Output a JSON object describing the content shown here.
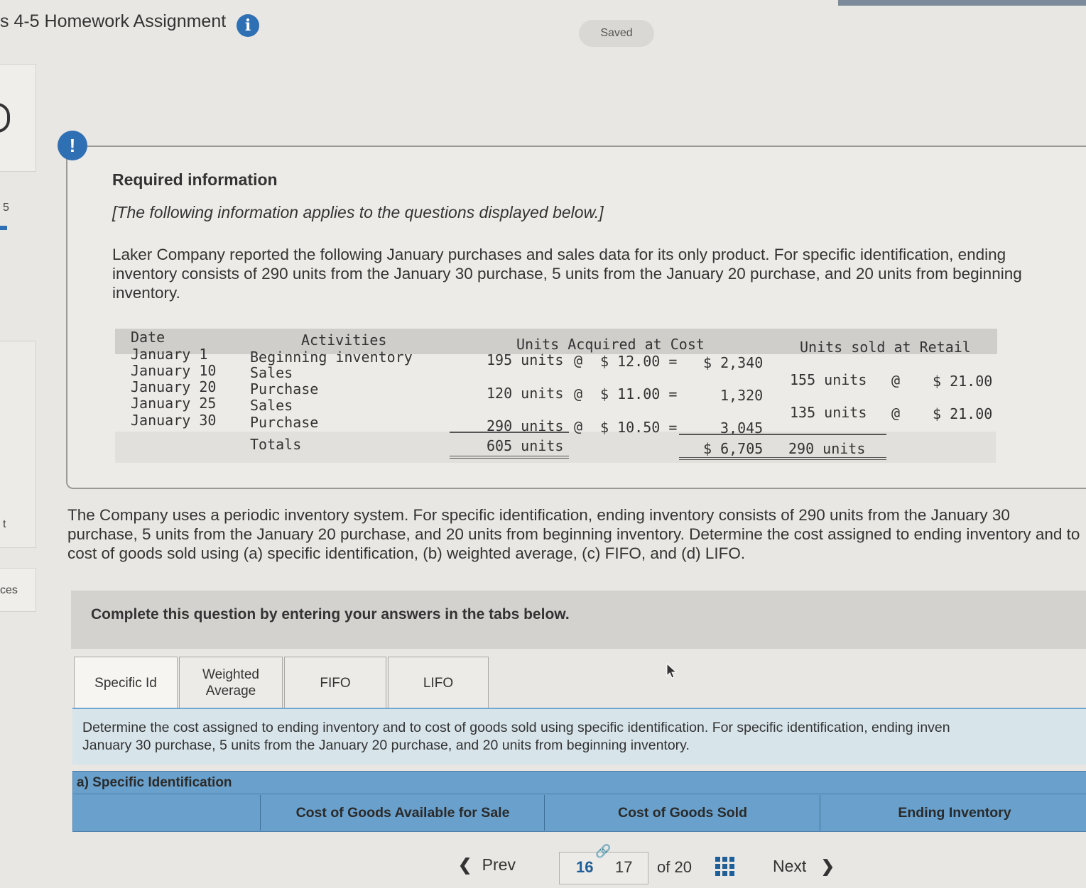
{
  "header": {
    "title": "s 4-5 Homework Assignment",
    "info_icon": "i",
    "saved": "Saved"
  },
  "sidebar": {
    "item_5": "5",
    "item_t": "t",
    "item_ces": "ces"
  },
  "info": {
    "alert_icon": "!",
    "title": "Required information",
    "note": "[The following information applies to the questions displayed below.]",
    "paragraph": "Laker Company reported the following January purchases and sales data for its only product. For specific identification, ending inventory consists of 290 units from the January 30 purchase, 5 units from the January 20 purchase, and 20 units from beginning inventory."
  },
  "table": {
    "headers": {
      "date": "Date",
      "activities": "Activities",
      "acquired": "Units Acquired at Cost",
      "sold": "Units sold at Retail"
    },
    "rows": [
      {
        "date": "January 1",
        "activity": "Beginning inventory",
        "acq_units": "195 units",
        "at": "@",
        "acq_cost": "$ 12.00 =",
        "acq_total": "$ 2,340",
        "sold_units": "",
        "sold_at": "",
        "sold_price": ""
      },
      {
        "date": "January 10",
        "activity": "Sales",
        "acq_units": "",
        "at": "",
        "acq_cost": "",
        "acq_total": "",
        "sold_units": "155 units",
        "sold_at": "@",
        "sold_price": "$ 21.00"
      },
      {
        "date": "January 20",
        "activity": "Purchase",
        "acq_units": "120 units",
        "at": "@",
        "acq_cost": "$ 11.00 =",
        "acq_total": "1,320",
        "sold_units": "",
        "sold_at": "",
        "sold_price": ""
      },
      {
        "date": "January 25",
        "activity": "Sales",
        "acq_units": "",
        "at": "",
        "acq_cost": "",
        "acq_total": "",
        "sold_units": "135 units",
        "sold_at": "@",
        "sold_price": "$ 21.00"
      },
      {
        "date": "January 30",
        "activity": "Purchase",
        "acq_units": "290 units",
        "at": "@",
        "acq_cost": "$ 10.50 =",
        "acq_total": "3,045",
        "sold_units": "",
        "sold_at": "",
        "sold_price": ""
      }
    ],
    "totals": {
      "label": "Totals",
      "acq_units": "605 units",
      "acq_total": "$ 6,705",
      "sold_units": "290 units"
    }
  },
  "question": {
    "text": "The Company uses a periodic inventory system. For specific identification, ending inventory consists of 290 units from the January 30 purchase, 5 units from the January 20 purchase, and 20 units from beginning inventory. Determine the cost assigned to ending inventory and to cost of goods sold using (a) specific identification, (b) weighted average, (c) FIFO, and (d) LIFO."
  },
  "complete": {
    "text": "Complete this question by entering your answers in the tabs below."
  },
  "tabs": [
    {
      "label": "Specific Id"
    },
    {
      "label": "Weighted Average"
    },
    {
      "label": "FIFO"
    },
    {
      "label": "LIFO"
    }
  ],
  "instruction": {
    "line1": "Determine the cost assigned to ending inventory and to cost of goods sold using specific identification. For specific identification, ending inven",
    "line2": "January 30 purchase, 5 units from the January 20 purchase, and 20 units from beginning inventory."
  },
  "answer_table": {
    "title": "a) Specific Identification",
    "col1": "Cost of Goods Available for Sale",
    "col2": "Cost of Goods Sold",
    "col3": "Ending Inventory"
  },
  "nav": {
    "prev": "Prev",
    "page_current": "16",
    "page_next": "17",
    "of": "of 20",
    "next": "Next"
  },
  "colors": {
    "accent_blue": "#2f6fb3",
    "table_blue": "#6aa1cc"
  }
}
